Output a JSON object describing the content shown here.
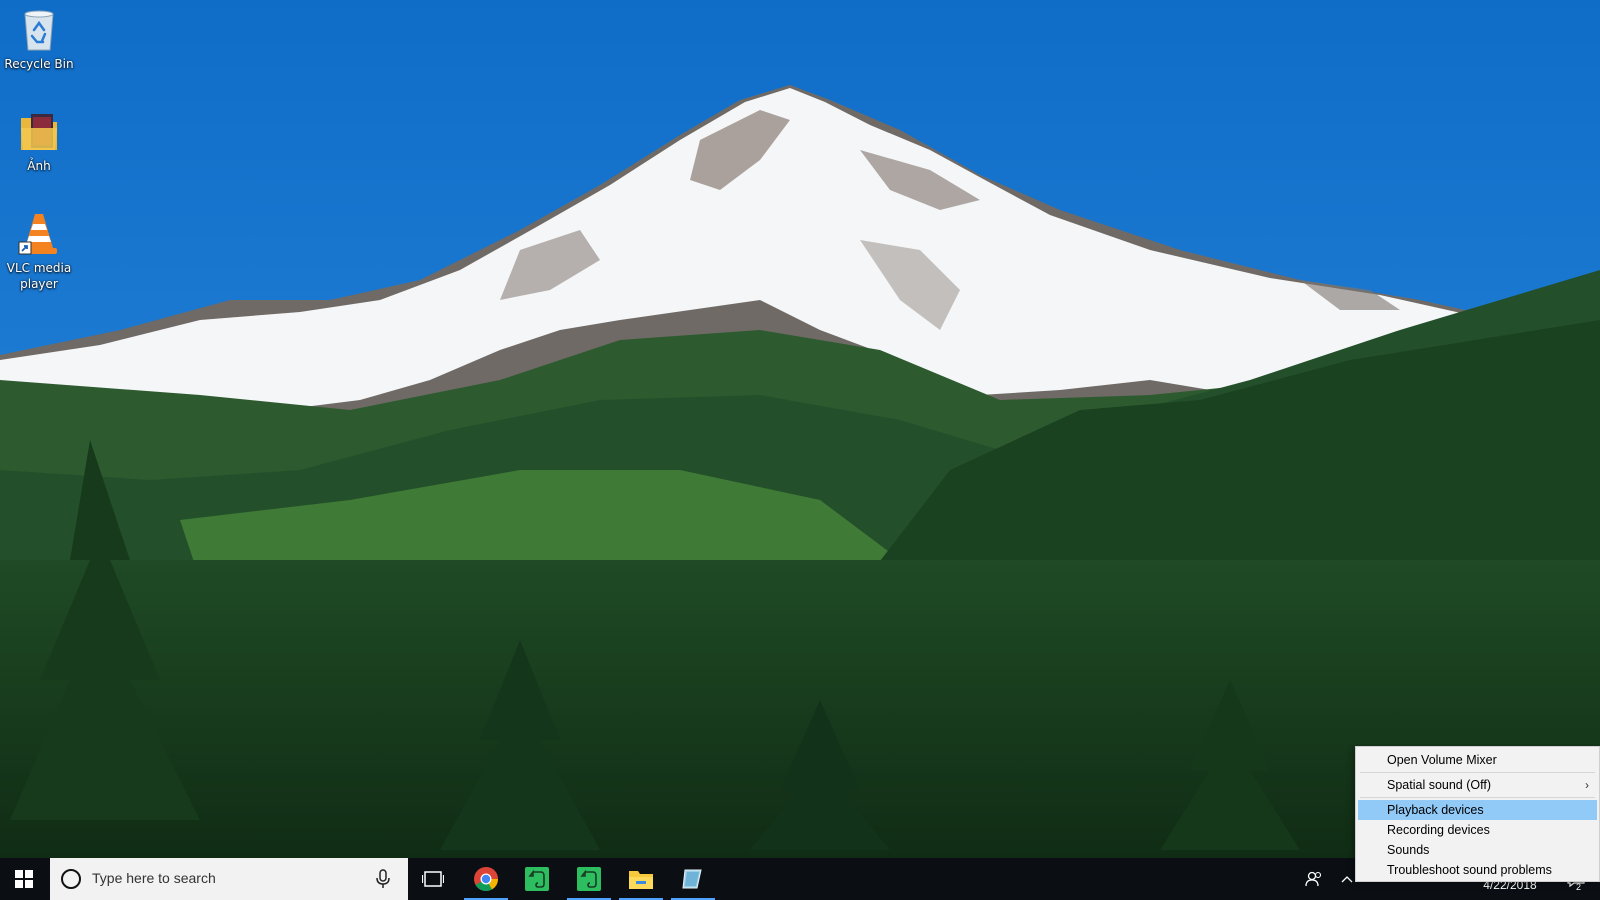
{
  "desktop": {
    "icons": [
      {
        "label": "Recycle Bin",
        "icon": "recycle-bin-icon"
      },
      {
        "label": "Ảnh",
        "icon": "photo-folder-icon"
      },
      {
        "label": "VLC media player",
        "icon": "vlc-cone-icon"
      }
    ]
  },
  "taskbar": {
    "search_placeholder": "Type here to search",
    "pinned": [
      {
        "icon": "task-view-icon",
        "active": false
      },
      {
        "icon": "chrome-icon",
        "active": true
      },
      {
        "icon": "evernote-icon",
        "active": false
      },
      {
        "icon": "evernote-icon",
        "active": true
      },
      {
        "icon": "file-explorer-icon",
        "active": true
      },
      {
        "icon": "app-icon",
        "active": true
      }
    ],
    "tray": {
      "date": "4/22/2018",
      "notification_count": "2"
    }
  },
  "context_menu": {
    "items": [
      {
        "label": "Open Volume Mixer"
      },
      {
        "label": "Spatial sound (Off)",
        "has_submenu": true,
        "arrow": "›"
      },
      {
        "label": "Playback devices",
        "highlighted": true
      },
      {
        "label": "Recording devices"
      },
      {
        "label": "Sounds"
      },
      {
        "label": "Troubleshoot sound problems"
      }
    ]
  },
  "colors": {
    "sky": "#1a75c9",
    "taskbar": "#0b0f14",
    "menu_bg": "#f2f2f2",
    "menu_highlight": "#91c9f7",
    "active_indicator": "#4fa3ff"
  }
}
